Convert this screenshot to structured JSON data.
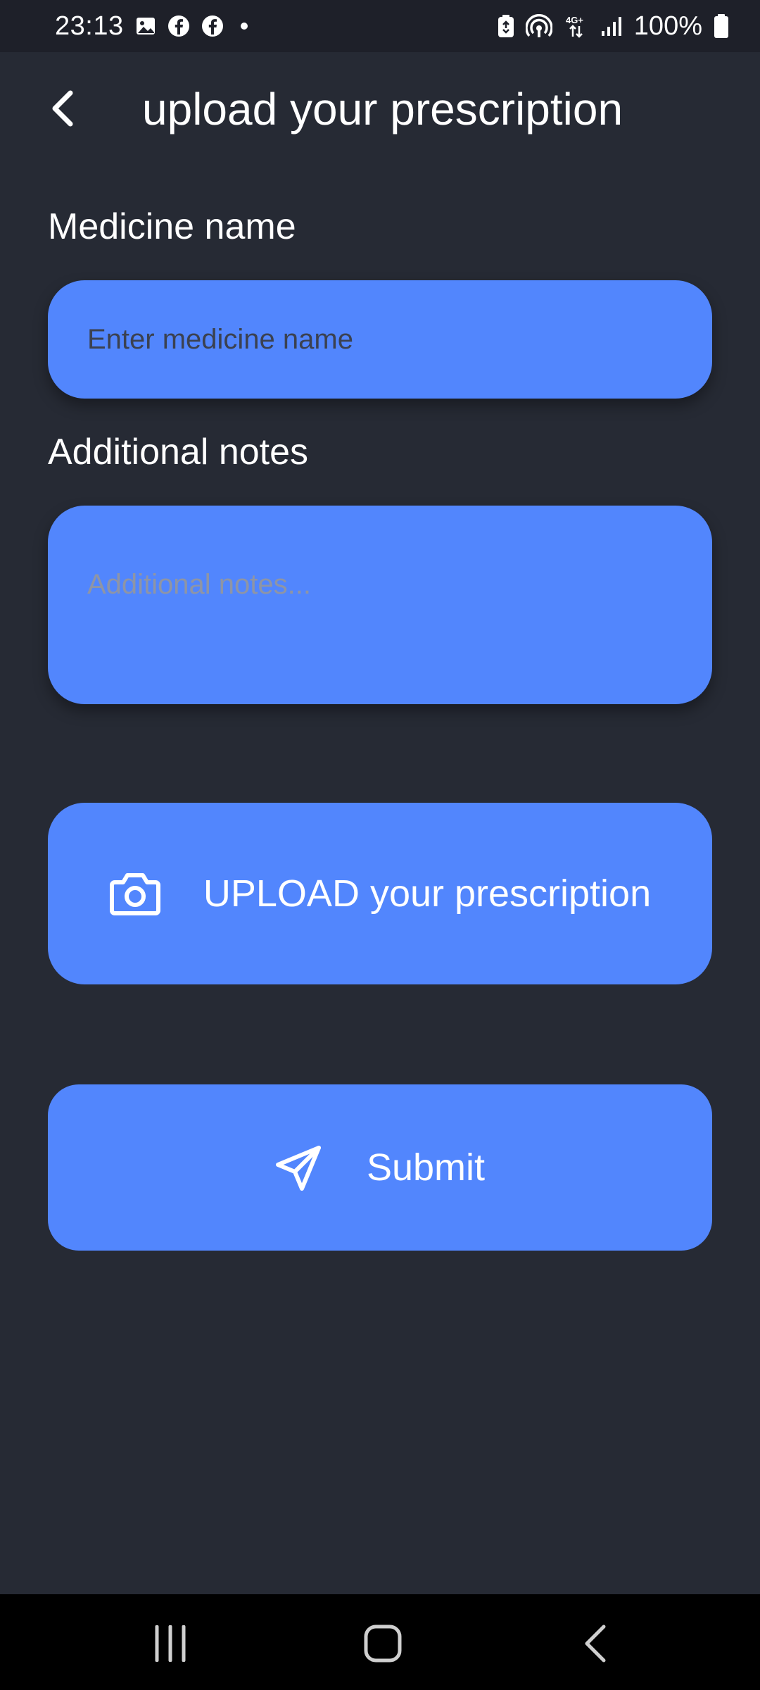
{
  "status_bar": {
    "time": "23:13",
    "battery": "100%",
    "network": "4G+",
    "notification_icons": [
      "gallery-icon",
      "facebook-icon",
      "facebook-icon",
      "dot-icon"
    ],
    "system_icons": [
      "battery-saver-icon",
      "hotspot-icon",
      "network-4g-icon",
      "signal-icon",
      "battery-icon"
    ]
  },
  "header": {
    "title": "upload your prescription",
    "back_icon": "chevron-left-icon"
  },
  "form": {
    "medicine": {
      "label": "Medicine name",
      "placeholder": "Enter medicine name",
      "value": ""
    },
    "notes": {
      "label": "Additional notes",
      "placeholder": "Additional notes...",
      "value": ""
    }
  },
  "actions": {
    "upload_label": "UPLOAD your prescription",
    "upload_icon": "camera-icon",
    "submit_label": "Submit",
    "submit_icon": "send-icon"
  },
  "nav_bar": {
    "items": [
      "recents-icon",
      "home-icon",
      "back-icon"
    ]
  },
  "colors": {
    "background": "#262a34",
    "status_bar": "#1e2029",
    "accent": "#5286fd",
    "nav_bar": "#000000"
  }
}
